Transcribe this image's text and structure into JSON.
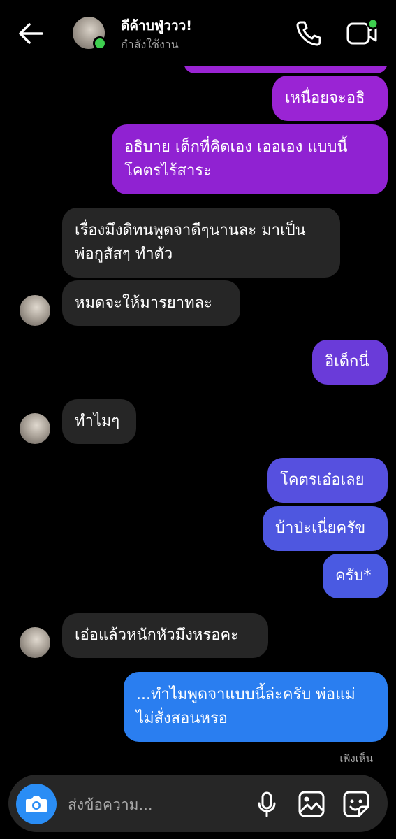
{
  "header": {
    "contact_name": "ดีค้าบฟู่ววว!",
    "status": "กำลังใช้งาน",
    "icons": [
      "back-arrow-icon",
      "phone-icon",
      "video-call-icon"
    ]
  },
  "messages": [
    {
      "id": "m1",
      "side": "out",
      "text": "เหนื่อยจะอธิ"
    },
    {
      "id": "m2",
      "side": "out",
      "text": "อธิบาย เด็กที่คิดเอง เออเอง แบบนี้\nโคตรไร้สาระ"
    },
    {
      "id": "m3",
      "side": "in",
      "text": "เรื่องมึงดิทนพูดจาดีๆนานละ มาเป็น\nพ่อกูสัสๆ ทำตัว"
    },
    {
      "id": "m4",
      "side": "in",
      "text": "หมดจะให้มารยาทละ"
    },
    {
      "id": "m5",
      "side": "out",
      "text": "อิเด็กนี่"
    },
    {
      "id": "m6",
      "side": "in",
      "text": "ทำไมๆ"
    },
    {
      "id": "m7",
      "side": "out",
      "text": "โคตรเอ๋อเลย"
    },
    {
      "id": "m8",
      "side": "out",
      "text": "บ้าป่ะเนี่ยครัข"
    },
    {
      "id": "m9",
      "side": "out",
      "text": "ครับ*"
    },
    {
      "id": "m10",
      "side": "in",
      "text": "เอ๋อแล้วหนักหัวมึงหรอคะ"
    },
    {
      "id": "m11",
      "side": "out",
      "text": "...ทำไมพูดจาแบบนี้ล่ะครับ พ่อแม่\nไม่สั่งสอนหรอ"
    }
  ],
  "seen_label": "เพิ่งเห็น",
  "composer": {
    "placeholder": "ส่งข้อความ...",
    "icons": [
      "camera-icon",
      "microphone-icon",
      "gallery-icon",
      "sticker-icon"
    ]
  },
  "colors": {
    "background": "#000000",
    "incoming_bubble": "#262626",
    "outgoing_purple": "#9a24d4",
    "outgoing_violet": "#6f40d9",
    "outgoing_indigo": "#4b55e0",
    "outgoing_blue": "#2a7ef0",
    "camera_button": "#2a8df5",
    "online": "#3ecf4f"
  }
}
